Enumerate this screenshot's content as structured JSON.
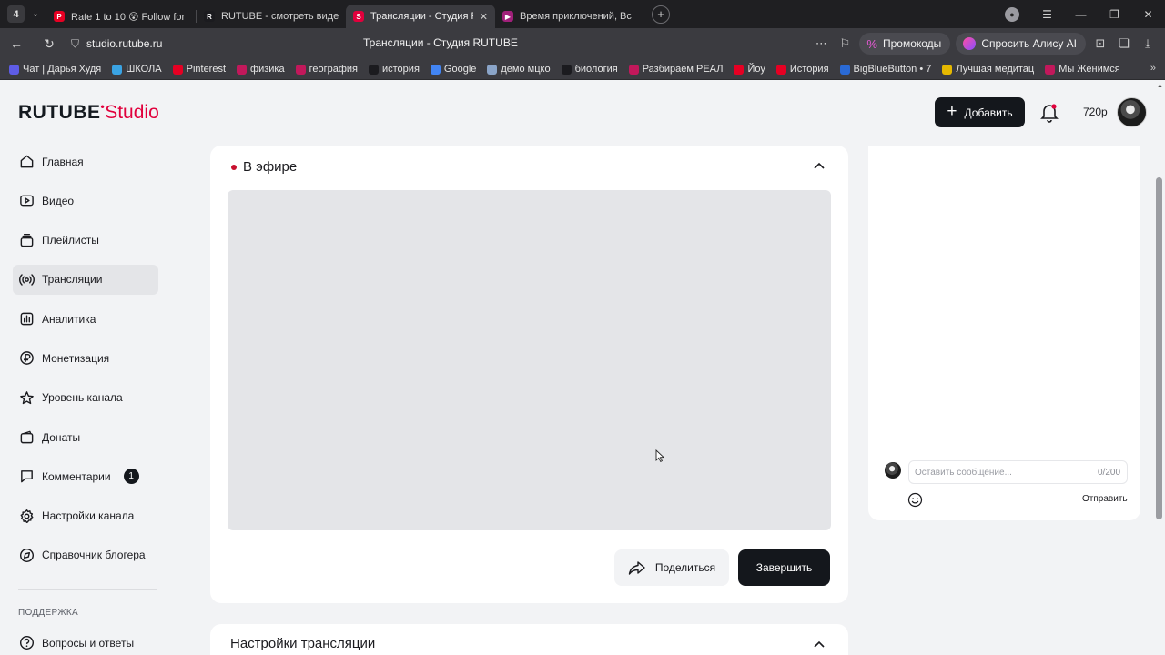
{
  "browser": {
    "workspace_badge": "4",
    "tabs": [
      {
        "title": "Rate 1 to 10 😵 Follow for",
        "favicon_color": "#e60023",
        "favicon_letter": "P"
      },
      {
        "title": "RUTUBE - смотреть виде",
        "favicon_color": "#1b1b1f",
        "favicon_letter": "R"
      },
      {
        "title": "Трансляции - Студия RUTUBE",
        "favicon_color": "#e1003c",
        "favicon_letter": "S"
      },
      {
        "title": "Время приключений, Вс",
        "favicon_color": "#a0207a",
        "favicon_letter": "▶"
      }
    ],
    "active_tab_index": 2,
    "url": "studio.rutube.ru",
    "page_title": "Трансляции - Студия RUTUBE",
    "promo_label": "Промокоды",
    "alice_label": "Спросить Алису AI",
    "bookmarks": [
      {
        "label": "Чат | Дарья Худя",
        "color": "#5e5ce6"
      },
      {
        "label": "ШКОЛА",
        "color": "#3aa3e3"
      },
      {
        "label": "Pinterest",
        "color": "#e60023"
      },
      {
        "label": "физика",
        "color": "#c2185b"
      },
      {
        "label": "география",
        "color": "#c2185b"
      },
      {
        "label": "история",
        "color": "#1b1b1f"
      },
      {
        "label": "Google",
        "color": "#4285f4"
      },
      {
        "label": "демо мцко",
        "color": "#8aa4c8"
      },
      {
        "label": "биология",
        "color": "#1b1b1f"
      },
      {
        "label": "Разбираем РЕАЛ",
        "color": "#c2185b"
      },
      {
        "label": "Йоу",
        "color": "#e60023"
      },
      {
        "label": "История",
        "color": "#e60023"
      },
      {
        "label": "BigBlueButton • 7",
        "color": "#2a6ad6"
      },
      {
        "label": "Лучшая медитац",
        "color": "#e5b800"
      },
      {
        "label": "Мы Женимся",
        "color": "#c2185b"
      }
    ]
  },
  "header": {
    "logo_main": "RUTUBE",
    "logo_studio": "Studio",
    "add_label": "Добавить",
    "resolution": "720p"
  },
  "sidebar": {
    "items": [
      {
        "label": "Главная",
        "icon": "home-icon"
      },
      {
        "label": "Видео",
        "icon": "video-icon"
      },
      {
        "label": "Плейлисты",
        "icon": "playlist-icon"
      },
      {
        "label": "Трансляции",
        "icon": "broadcast-icon",
        "active": true
      },
      {
        "label": "Аналитика",
        "icon": "analytics-icon"
      },
      {
        "label": "Монетизация",
        "icon": "monetization-icon"
      },
      {
        "label": "Уровень канала",
        "icon": "star-icon"
      },
      {
        "label": "Донаты",
        "icon": "donation-icon"
      },
      {
        "label": "Комментарии",
        "icon": "comment-icon",
        "badge": "1"
      },
      {
        "label": "Настройки канала",
        "icon": "gear-icon"
      },
      {
        "label": "Справочник блогера",
        "icon": "help-icon"
      }
    ],
    "support_section": "ПОДДЕРЖКА",
    "faq_label": "Вопросы и ответы"
  },
  "live": {
    "title": "В эфире",
    "share_label": "Поделиться",
    "end_label": "Завершить"
  },
  "settings": {
    "title": "Настройки трансляции"
  },
  "chat": {
    "placeholder": "Оставить сообщение...",
    "counter": "0/200",
    "send_label": "Отправить"
  }
}
